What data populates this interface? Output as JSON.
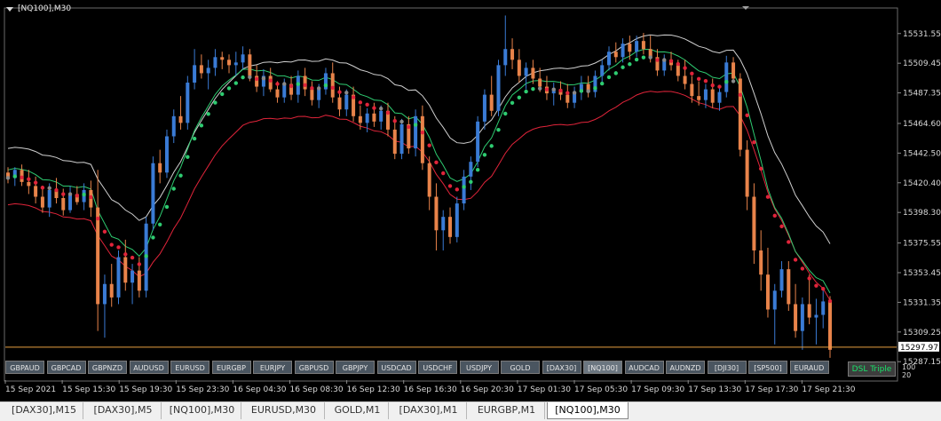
{
  "chart": {
    "title": "[NQ100],M30",
    "symbol": "NQ100",
    "timeframe": "M30",
    "current_price": "15297.97",
    "bid_line_label": "15297.97",
    "background": "#000000",
    "bull_color": "#3a7bd5",
    "bear_color": "#e8834a",
    "dsl_up_color": "#2ecc71",
    "dsl_down_color": "#e0243a",
    "dsl_neutral_color": "#8a8a8a",
    "band_upper_color": "#d0d0d0",
    "band_mid_color": "#2ecc71",
    "band_low_color": "#e0243a",
    "hline_color": "#e8a040",
    "price_labels": [
      "15531.55",
      "15509.45",
      "15487.35",
      "15464.60",
      "15442.50",
      "15420.40",
      "15398.30",
      "15375.55",
      "15353.45",
      "15331.35",
      "15309.25",
      "15287.15"
    ],
    "time_labels": [
      "15 Sep 2021",
      "15 Sep 15:30",
      "15 Sep 19:30",
      "15 Sep 23:30",
      "16 Sep 04:30",
      "16 Sep 08:30",
      "16 Sep 12:30",
      "16 Sep 16:30",
      "16 Sep 20:30",
      "17 Sep 01:30",
      "17 Sep 05:30",
      "17 Sep 09:30",
      "17 Sep 13:30",
      "17 Sep 17:30",
      "17 Sep 21:30"
    ],
    "sub_scale": [
      "100",
      "20"
    ]
  },
  "symbols": [
    "GBPAUD",
    "GBPCAD",
    "GBPNZD",
    "AUDUSD",
    "EURUSD",
    "EURGBP",
    "EURJPY",
    "GBPUSD",
    "GBPJPY",
    "USDCAD",
    "USDCHF",
    "USDJPY",
    "GOLD",
    "[DAX30]",
    "[NQ100]",
    "AUDCAD",
    "AUDNZD",
    "[DJI30]",
    "[SP500]",
    "EURAUD"
  ],
  "active_symbol": "[NQ100]",
  "dsl_badge": "DSL Triple",
  "tabs": [
    "[DAX30],M15",
    "[DAX30],M5",
    "[NQ100],M30",
    "EURUSD,M30",
    "GOLD,M1",
    "[DAX30],M1",
    "EURGBP,M1",
    "[NQ100],M30"
  ],
  "active_tab_index": 7,
  "candles_ohlc": [
    [
      15428,
      15432,
      15420,
      15424
    ],
    [
      15424,
      15432,
      15418,
      15430
    ],
    [
      15430,
      15434,
      15418,
      15421
    ],
    [
      15421,
      15430,
      15412,
      15418
    ],
    [
      15418,
      15425,
      15405,
      15410
    ],
    [
      15410,
      15418,
      15398,
      15402
    ],
    [
      15402,
      15420,
      15395,
      15415
    ],
    [
      15415,
      15424,
      15405,
      15409
    ],
    [
      15409,
      15416,
      15396,
      15400
    ],
    [
      15400,
      15418,
      15398,
      15412
    ],
    [
      15412,
      15418,
      15404,
      15406
    ],
    [
      15406,
      15420,
      15400,
      15415
    ],
    [
      15415,
      15422,
      15395,
      15402
    ],
    [
      15402,
      15430,
      15310,
      15330
    ],
    [
      15330,
      15352,
      15305,
      15345
    ],
    [
      15345,
      15360,
      15328,
      15335
    ],
    [
      15335,
      15370,
      15330,
      15365
    ],
    [
      15365,
      15378,
      15340,
      15346
    ],
    [
      15346,
      15360,
      15330,
      15355
    ],
    [
      15355,
      15365,
      15335,
      15340
    ],
    [
      15340,
      15395,
      15335,
      15390
    ],
    [
      15390,
      15440,
      15385,
      15435
    ],
    [
      15435,
      15445,
      15420,
      15428
    ],
    [
      15428,
      15460,
      15424,
      15455
    ],
    [
      15455,
      15475,
      15450,
      15470
    ],
    [
      15470,
      15485,
      15460,
      15465
    ],
    [
      15465,
      15500,
      15460,
      15495
    ],
    [
      15495,
      15520,
      15490,
      15508
    ],
    [
      15508,
      15516,
      15498,
      15502
    ],
    [
      15502,
      15512,
      15490,
      15506
    ],
    [
      15506,
      15520,
      15500,
      15514
    ],
    [
      15514,
      15518,
      15505,
      15512
    ],
    [
      15512,
      15516,
      15502,
      15508
    ],
    [
      15508,
      15518,
      15500,
      15510
    ],
    [
      15510,
      15522,
      15505,
      15516
    ],
    [
      15516,
      15520,
      15496,
      15500
    ],
    [
      15500,
      15508,
      15488,
      15492
    ],
    [
      15492,
      15505,
      15485,
      15500
    ],
    [
      15500,
      15506,
      15488,
      15490
    ],
    [
      15490,
      15496,
      15480,
      15484
    ],
    [
      15484,
      15498,
      15480,
      15494
    ],
    [
      15494,
      15500,
      15482,
      15486
    ],
    [
      15486,
      15504,
      15480,
      15500
    ],
    [
      15500,
      15506,
      15485,
      15490
    ],
    [
      15490,
      15496,
      15478,
      15482
    ],
    [
      15482,
      15494,
      15476,
      15490
    ],
    [
      15490,
      15506,
      15486,
      15502
    ],
    [
      15502,
      15510,
      15480,
      15484
    ],
    [
      15484,
      15492,
      15470,
      15475
    ],
    [
      15475,
      15490,
      15470,
      15486
    ],
    [
      15486,
      15492,
      15466,
      15470
    ],
    [
      15470,
      15478,
      15460,
      15465
    ],
    [
      15465,
      15476,
      15458,
      15472
    ],
    [
      15472,
      15480,
      15462,
      15466
    ],
    [
      15466,
      15478,
      15460,
      15474
    ],
    [
      15474,
      15480,
      15455,
      15460
    ],
    [
      15460,
      15470,
      15438,
      15442
    ],
    [
      15442,
      15468,
      15438,
      15464
    ],
    [
      15464,
      15470,
      15442,
      15446
    ],
    [
      15446,
      15475,
      15440,
      15470
    ],
    [
      15470,
      15478,
      15430,
      15435
    ],
    [
      15435,
      15440,
      15400,
      15410
    ],
    [
      15410,
      15420,
      15370,
      15385
    ],
    [
      15385,
      15400,
      15370,
      15395
    ],
    [
      15395,
      15402,
      15375,
      15380
    ],
    [
      15380,
      15410,
      15376,
      15405
    ],
    [
      15405,
      15430,
      15400,
      15425
    ],
    [
      15425,
      15440,
      15415,
      15436
    ],
    [
      15436,
      15470,
      15432,
      15466
    ],
    [
      15466,
      15490,
      15460,
      15486
    ],
    [
      15486,
      15500,
      15470,
      15474
    ],
    [
      15474,
      15512,
      15470,
      15508
    ],
    [
      15508,
      15545,
      15500,
      15520
    ],
    [
      15520,
      15528,
      15505,
      15512
    ],
    [
      15512,
      15520,
      15495,
      15500
    ],
    [
      15500,
      15510,
      15490,
      15506
    ],
    [
      15506,
      15512,
      15494,
      15498
    ],
    [
      15498,
      15506,
      15488,
      15492
    ],
    [
      15492,
      15500,
      15482,
      15487
    ],
    [
      15487,
      15495,
      15478,
      15490
    ],
    [
      15490,
      15496,
      15482,
      15486
    ],
    [
      15486,
      15494,
      15476,
      15480
    ],
    [
      15480,
      15492,
      15476,
      15488
    ],
    [
      15488,
      15500,
      15482,
      15494
    ],
    [
      15494,
      15500,
      15484,
      15488
    ],
    [
      15488,
      15504,
      15484,
      15500
    ],
    [
      15500,
      15512,
      15494,
      15508
    ],
    [
      15508,
      15522,
      15504,
      15518
    ],
    [
      15518,
      15525,
      15510,
      15514
    ],
    [
      15514,
      15528,
      15510,
      15524
    ],
    [
      15524,
      15530,
      15512,
      15518
    ],
    [
      15518,
      15530,
      15514,
      15526
    ],
    [
      15526,
      15532,
      15516,
      15520
    ],
    [
      15520,
      15530,
      15510,
      15514
    ],
    [
      15514,
      15520,
      15500,
      15504
    ],
    [
      15504,
      15516,
      15500,
      15512
    ],
    [
      15512,
      15518,
      15504,
      15508
    ],
    [
      15508,
      15512,
      15496,
      15500
    ],
    [
      15500,
      15512,
      15490,
      15494
    ],
    [
      15494,
      15500,
      15480,
      15485
    ],
    [
      15485,
      15496,
      15478,
      15482
    ],
    [
      15482,
      15494,
      15476,
      15490
    ],
    [
      15490,
      15498,
      15476,
      15480
    ],
    [
      15480,
      15492,
      15474,
      15488
    ],
    [
      15488,
      15515,
      15484,
      15510
    ],
    [
      15510,
      15514,
      15496,
      15498
    ],
    [
      15498,
      15502,
      15440,
      15445
    ],
    [
      15445,
      15452,
      15400,
      15410
    ],
    [
      15410,
      15420,
      15360,
      15370
    ],
    [
      15370,
      15385,
      15340,
      15352
    ],
    [
      15352,
      15372,
      15320,
      15326
    ],
    [
      15326,
      15345,
      15300,
      15340
    ],
    [
      15340,
      15362,
      15335,
      15356
    ],
    [
      15356,
      15362,
      15325,
      15330
    ],
    [
      15330,
      15345,
      15305,
      15310
    ],
    [
      15310,
      15335,
      15296,
      15330
    ],
    [
      15330,
      15352,
      15315,
      15320
    ],
    [
      15320,
      15334,
      15300,
      15322
    ],
    [
      15322,
      15340,
      15312,
      15332
    ],
    [
      15332,
      15336,
      15290,
      15296
    ]
  ]
}
